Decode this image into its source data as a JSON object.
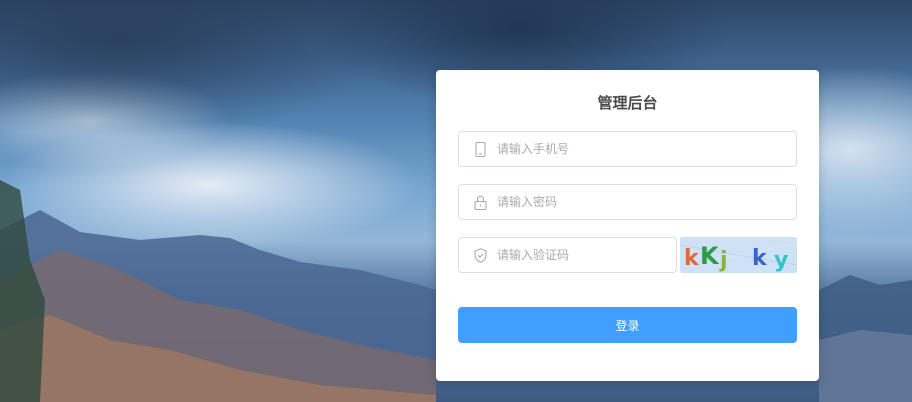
{
  "login": {
    "title": "管理后台",
    "phone_placeholder": "请输入手机号",
    "password_placeholder": "请输入密码",
    "captcha_placeholder": "请输入验证码",
    "captcha_text": "kKj ky",
    "submit_label": "登录"
  },
  "icons": {
    "phone": "phone-icon",
    "password": "lock-icon",
    "captcha": "shield-icon"
  },
  "colors": {
    "primary": "#409eff",
    "card_bg": "#ffffff",
    "border": "#dcdfe6",
    "placeholder": "#a8abb2",
    "title": "#4a4a4a"
  }
}
